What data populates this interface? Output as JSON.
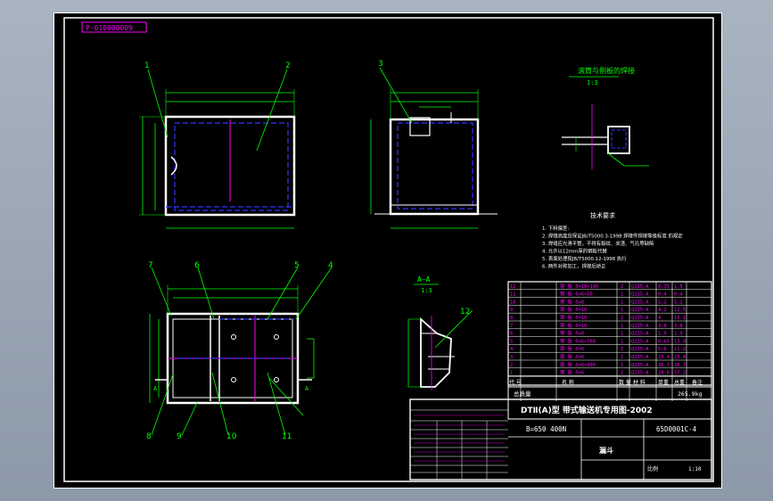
{
  "drawing": {
    "code_box": "P-010000009",
    "part_labels": [
      "1",
      "2",
      "3",
      "4",
      "5",
      "6",
      "7",
      "8",
      "9",
      "10",
      "11",
      "12"
    ],
    "detail_title": "滚筒与侧板的焊接",
    "detail_scale": "1:3",
    "section_title": "A—A",
    "section_scale": "1:3",
    "section_marker": "A",
    "tech_req_title": "技术要求",
    "tech_req": [
      "1. 下料偏差:",
      "2. 焊缝高度应保证JB/T5000.3-1998 焊接件焊接等级标准  的规定",
      "3. 焊缝应光滑平整，不得有裂纹、夹渣、气孔等缺陷",
      "4. 允许以12mm厚的钢板代替",
      "5. 表面处理按JB/T5000.12-1998 执行",
      "6. 两件对称加工，焊接后矫正"
    ],
    "title_main": "DTⅡ(A)型  带式输送机专用图-2002",
    "drawing_no": "B=650 400N",
    "part_no": "65D0001C-4",
    "part_name": "漏斗",
    "total_weight_label": "总质量",
    "total_weight": "265.9kg",
    "scale_label": "比例",
    "scale_value": "1:10",
    "header_labels": [
      "代 号",
      "名  称",
      "数 量",
      "材  料",
      "单重",
      "总重",
      "备注"
    ],
    "bom_rows": [
      {
        "no": "12",
        "name": "钢  板 δ=10×100",
        "qty": "2",
        "mat": "Q235-A",
        "w1": "0.35",
        "w2": "1.5"
      },
      {
        "no": "11",
        "name": "钢  板 δ=6×50",
        "qty": "1",
        "mat": "Q235-A",
        "w1": "0.4",
        "w2": "0.4"
      },
      {
        "no": "10",
        "name": "钢  板 δ=8",
        "qty": "1",
        "mat": "Q235-A",
        "w1": "5.2",
        "w2": "5.2"
      },
      {
        "no": "9",
        "name": "钢  板 δ=10",
        "qty": "1",
        "mat": "Q235-A",
        "w1": "4.2",
        "w2": "12.5"
      },
      {
        "no": "8",
        "name": "钢  板 δ=10",
        "qty": "2",
        "mat": "Q235-A",
        "w1": "4",
        "w2": "15.1"
      },
      {
        "no": "7",
        "name": "钢  板 δ=10",
        "qty": "1",
        "mat": "Q235-A",
        "w1": "3.8",
        "w2": "3.8"
      },
      {
        "no": "6",
        "name": "钢  板 δ=8",
        "qty": "1",
        "mat": "Q235-A",
        "w1": "1.9",
        "w2": "1.9"
      },
      {
        "no": "5",
        "name": "钢  板 δ=6×760",
        "qty": "1",
        "mat": "Q235-A",
        "w1": "0.65",
        "w2": "13.9"
      },
      {
        "no": "4",
        "name": "钢  板 δ=6",
        "qty": "2",
        "mat": "Q235-A",
        "w1": "5.6",
        "w2": "11.2"
      },
      {
        "no": "3",
        "name": "钢  板 δ=6",
        "qty": "1",
        "mat": "Q235-A",
        "w1": "23.4",
        "w2": "23.4"
      },
      {
        "no": "2",
        "name": "钢  板 δ=6×900",
        "qty": "1",
        "mat": "Q235-A",
        "w1": "36.7",
        "w2": "36.7"
      },
      {
        "no": "1",
        "name": "钢  板 δ=6",
        "qty": "2",
        "mat": "Q235-A",
        "w1": "28.6",
        "w2": "57.2"
      }
    ]
  }
}
